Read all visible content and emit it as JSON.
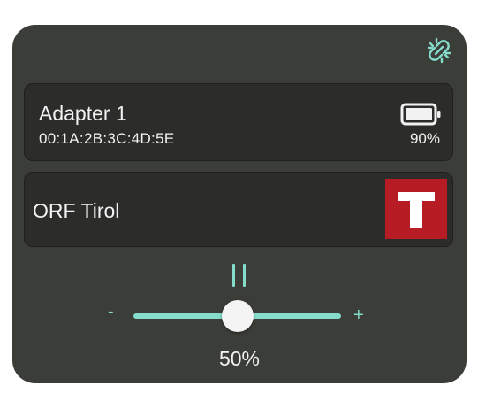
{
  "header": {
    "unlink_icon": "link-broken-icon",
    "accent_color": "#86dccb"
  },
  "adapter": {
    "name": "Adapter 1",
    "mac": "00:1A:2B:3C:4D:5E",
    "battery_icon": "battery-full-icon",
    "battery_text": "90%",
    "battery_level": 0.9
  },
  "station": {
    "name": "ORF Tirol",
    "logo_letter": "T",
    "logo_color": "#b71c24"
  },
  "playback": {
    "control_icon": "pause-icon"
  },
  "volume": {
    "minus_label": "-",
    "plus_label": "+",
    "value": 0.5,
    "value_text": "50%"
  }
}
